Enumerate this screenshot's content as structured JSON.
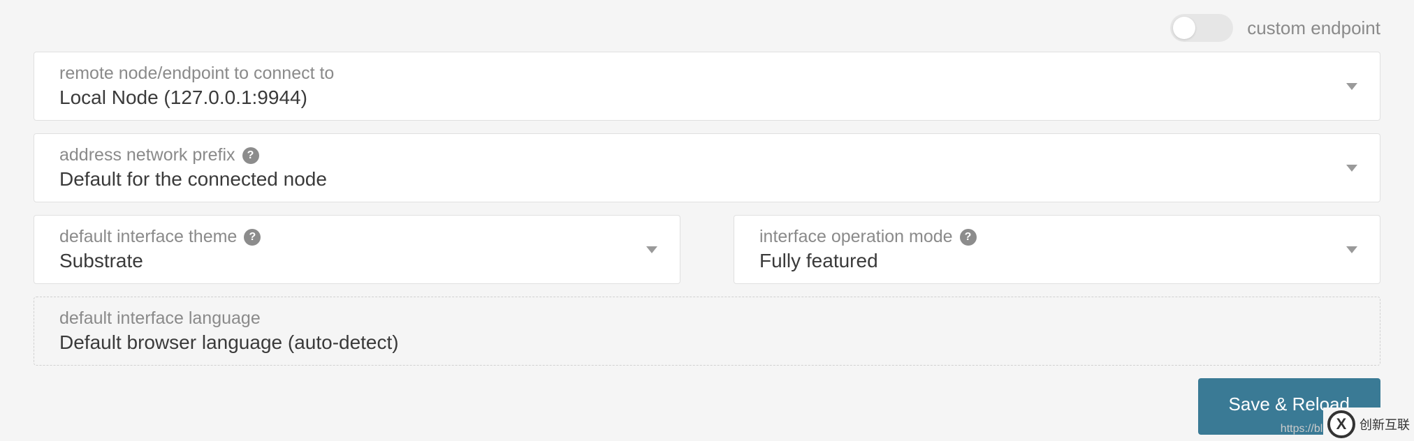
{
  "toggle": {
    "label": "custom endpoint",
    "state": false
  },
  "fields": {
    "endpoint": {
      "label": "remote node/endpoint to connect to",
      "value": "Local Node (127.0.0.1:9944)"
    },
    "prefix": {
      "label": "address network prefix",
      "value": "Default for the connected node"
    },
    "theme": {
      "label": "default interface theme",
      "value": "Substrate"
    },
    "mode": {
      "label": "interface operation mode",
      "value": "Fully featured"
    },
    "language": {
      "label": "default interface language",
      "value": "Default browser language (auto-detect)"
    }
  },
  "buttons": {
    "save": "Save & Reload"
  },
  "watermark": "https://blog.csdn.net",
  "brand": {
    "mark": "X",
    "text": "创新互联"
  }
}
